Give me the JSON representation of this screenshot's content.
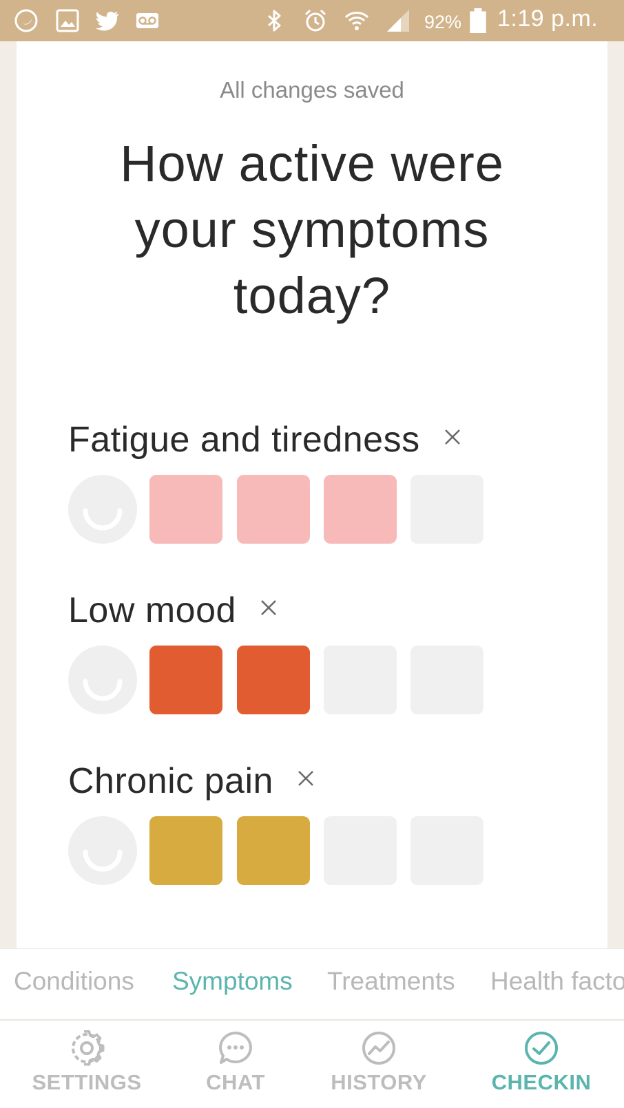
{
  "status_bar": {
    "battery_percent": "92%",
    "time": "1:19 p.m.",
    "icons": [
      "moon-icon",
      "image-icon",
      "twitter-icon",
      "voicemail-icon",
      "bluetooth-icon",
      "alarm-icon",
      "wifi-icon",
      "signal-icon",
      "battery-icon"
    ]
  },
  "main": {
    "save_status": "All changes saved",
    "question_lines": [
      "How active were",
      "your symptoms",
      "today?"
    ],
    "symptoms": [
      {
        "name": "Fatigue and tiredness",
        "level": 3,
        "max_level": 4,
        "color": "#f8b9b9"
      },
      {
        "name": "Low mood",
        "level": 2,
        "max_level": 4,
        "color": "#e25c32"
      },
      {
        "name": "Chronic pain",
        "level": 2,
        "max_level": 4,
        "color": "#d8ab40"
      }
    ],
    "empty_color": "#f0f0f0"
  },
  "subtabs": {
    "items": [
      {
        "label": "Conditions",
        "active": false
      },
      {
        "label": "Symptoms",
        "active": true
      },
      {
        "label": "Treatments",
        "active": false
      },
      {
        "label": "Health facto",
        "active": false
      }
    ]
  },
  "bottom_nav": {
    "items": [
      {
        "label": "SETTINGS",
        "icon": "gear-icon",
        "active": false
      },
      {
        "label": "CHAT",
        "icon": "chat-icon",
        "active": false
      },
      {
        "label": "HISTORY",
        "icon": "chart-icon",
        "active": false
      },
      {
        "label": "CHECKIN",
        "icon": "check-circle-icon",
        "active": true
      }
    ],
    "accent_color": "#5bb5ae",
    "inactive_color": "#bdbdbd"
  }
}
